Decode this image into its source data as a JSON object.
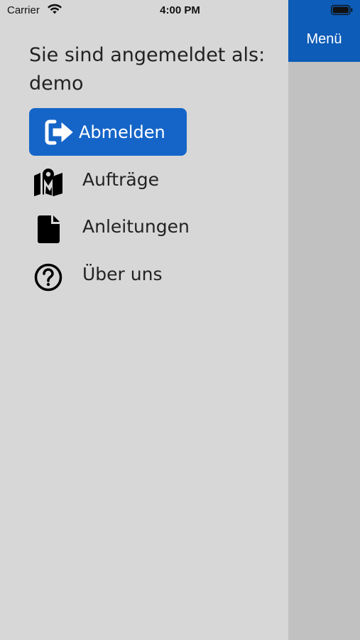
{
  "status_bar": {
    "carrier": "Carrier",
    "time": "4:00 PM"
  },
  "nav": {
    "menu_label": "Menü",
    "accent_color": "#0d5cb7"
  },
  "account": {
    "signed_in_label": "Sie sind angemeldet als:",
    "username": "demo"
  },
  "logout": {
    "label": "Abmelden",
    "icon": "sign-out-icon",
    "color": "#1565c8"
  },
  "menu": {
    "items": [
      {
        "label": "Aufträge",
        "icon": "map-marker-icon"
      },
      {
        "label": "Anleitungen",
        "icon": "document-icon"
      },
      {
        "label": "Über uns",
        "icon": "question-circle-icon"
      }
    ]
  }
}
